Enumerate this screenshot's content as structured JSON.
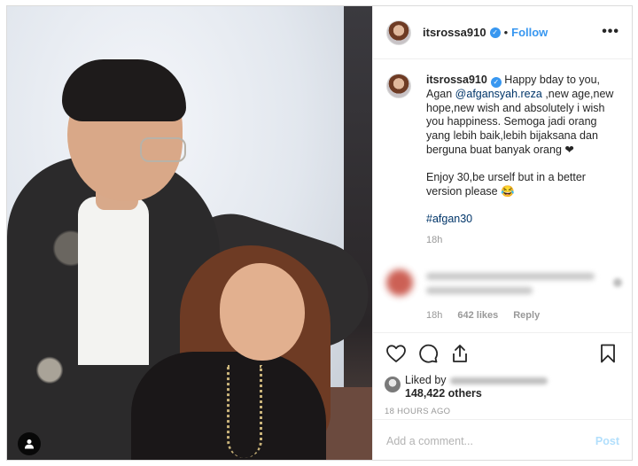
{
  "post": {
    "username": "itsrossa910",
    "follow_label": "Follow",
    "separator": "•",
    "more_label": "•••"
  },
  "caption": {
    "username": "itsrossa910",
    "line1_pre": "Happy bday to you, Agan ",
    "mention": "@afgansyah.reza",
    "line1_post": " ,new age,new hope,new wish and absolutely i wish you happiness. Semoga jadi orang yang lebih baik,lebih bijaksana dan berguna buat banyak orang ❤",
    "line2": "Enjoy 30,be urself but in a better version please 😂",
    "hashtag": "#afgan30",
    "time": "18h"
  },
  "comment": {
    "time": "18h",
    "likes": "642 likes",
    "reply_label": "Reply"
  },
  "likes": {
    "prefix": "Liked by",
    "others": "148,422 others"
  },
  "timestamp": "18 HOURS AGO",
  "add_comment": {
    "placeholder": "Add a comment...",
    "post_label": "Post"
  },
  "icons": {
    "like": "heart-icon",
    "comment": "comment-icon",
    "share": "share-icon",
    "save": "bookmark-icon",
    "tag": "user-tag-icon",
    "verified": "verified-badge-icon"
  },
  "colors": {
    "accent": "#3897f0",
    "link": "#003569",
    "post_disabled": "#b2dffc",
    "muted": "#999999"
  }
}
